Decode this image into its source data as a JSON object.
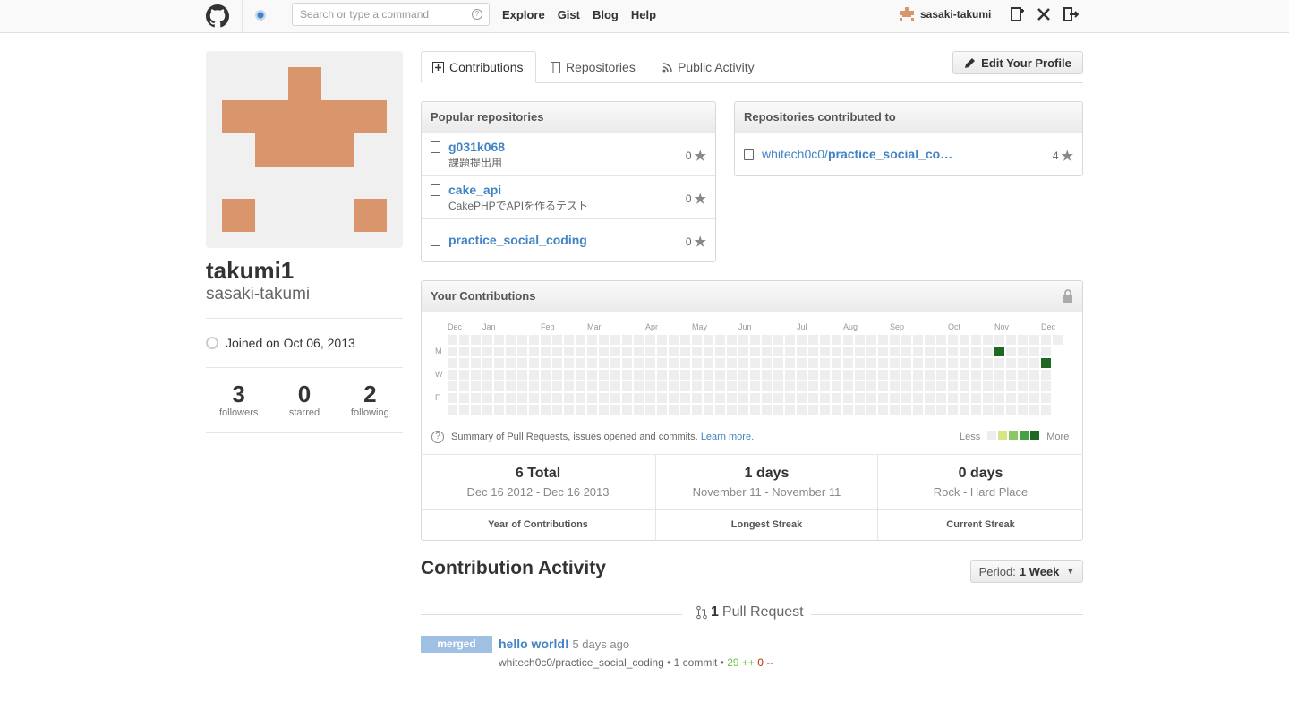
{
  "header": {
    "search_placeholder": "Search or type a command",
    "nav": [
      "Explore",
      "Gist",
      "Blog",
      "Help"
    ],
    "username": "sasaki-takumi"
  },
  "profile": {
    "name": "takumi1",
    "login": "sasaki-takumi",
    "joined": "Joined on Oct 06, 2013",
    "stats": [
      {
        "value": "3",
        "label": "followers"
      },
      {
        "value": "0",
        "label": "starred"
      },
      {
        "value": "2",
        "label": "following"
      }
    ]
  },
  "tabs": {
    "contributions": "Contributions",
    "repositories": "Repositories",
    "public_activity": "Public Activity"
  },
  "edit_profile": "Edit Your Profile",
  "popular": {
    "title": "Popular repositories",
    "repos": [
      {
        "name": "g031k068",
        "desc": "課題提出用",
        "stars": "0"
      },
      {
        "name": "cake_api",
        "desc": "CakePHPでAPIを作るテスト",
        "stars": "0"
      },
      {
        "name": "practice_social_coding",
        "desc": "",
        "stars": "0"
      }
    ]
  },
  "contributed": {
    "title": "Repositories contributed to",
    "repos": [
      {
        "owner": "whitech0c0/",
        "name": "practice_social_co…",
        "stars": "4"
      }
    ]
  },
  "contributions": {
    "title": "Your Contributions",
    "months": [
      "Dec",
      "Jan",
      "Feb",
      "Mar",
      "Apr",
      "May",
      "Jun",
      "Jul",
      "Aug",
      "Sep",
      "Oct",
      "Nov",
      "Dec"
    ],
    "days": [
      "M",
      "W",
      "F"
    ],
    "summary": "Summary of Pull Requests, issues opened and commits.",
    "learn_more": "Learn more.",
    "less": "Less",
    "more": "More",
    "legend_colors": [
      "#eeeeee",
      "#d6e685",
      "#8cc665",
      "#44a340",
      "#1e6823"
    ],
    "active_cells": [
      {
        "week": 47,
        "day": 1,
        "color": "#1e6823"
      },
      {
        "week": 51,
        "day": 2,
        "color": "#1e6823"
      }
    ],
    "streaks": [
      {
        "value": "6 Total",
        "range": "Dec 16 2012 - Dec 16 2013",
        "label": "Year of Contributions"
      },
      {
        "value": "1 days",
        "range": "November 11 - November 11",
        "label": "Longest Streak"
      },
      {
        "value": "0 days",
        "range": "Rock - Hard Place",
        "label": "Current Streak"
      }
    ]
  },
  "activity": {
    "title": "Contribution Activity",
    "period_label": "Period:",
    "period_value": "1 Week",
    "pr_count": "1",
    "pr_label": "Pull Request",
    "item": {
      "badge": "merged",
      "title": "hello world!",
      "ago": "5 days ago",
      "repo": "whitech0c0/practice_social_coding",
      "commits": "1 commit",
      "additions": "29 ++",
      "deletions": "0 --"
    }
  }
}
